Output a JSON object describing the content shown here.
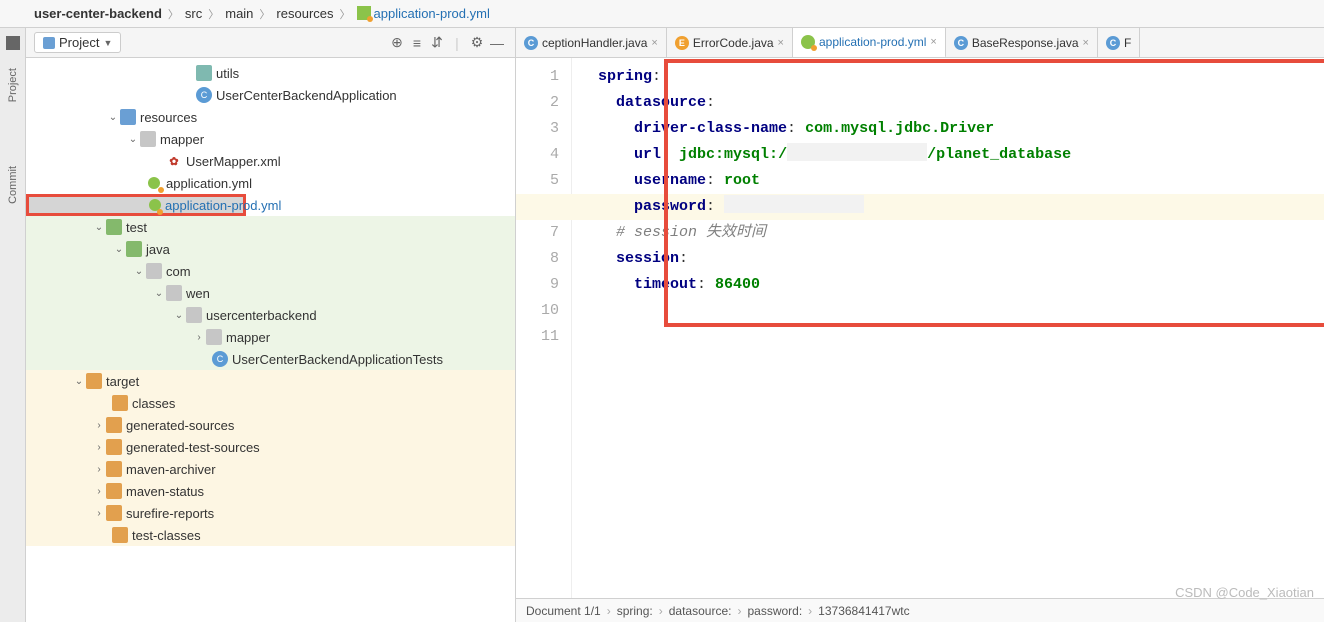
{
  "breadcrumbs": [
    "user-center-backend",
    "src",
    "main",
    "resources",
    "application-prod.yml"
  ],
  "left_rail": {
    "project": "Project",
    "commit": "Commit"
  },
  "panel_title": "Project",
  "tree": {
    "utils": "utils",
    "app_class": "UserCenterBackendApplication",
    "resources": "resources",
    "mapper": "mapper",
    "usermapper_xml": "UserMapper.xml",
    "app_yml": "application.yml",
    "app_prod_yml": "application-prod.yml",
    "test": "test",
    "java": "java",
    "com": "com",
    "wen": "wen",
    "usercenterbackend": "usercenterbackend",
    "mapper2": "mapper",
    "tests_class": "UserCenterBackendApplicationTests",
    "target": "target",
    "classes": "classes",
    "gen_sources": "generated-sources",
    "gen_test_sources": "generated-test-sources",
    "maven_archiver": "maven-archiver",
    "maven_status": "maven-status",
    "surefire": "surefire-reports",
    "test_classes": "test-classes"
  },
  "tabs": [
    {
      "icon": "java-c",
      "label": "ceptionHandler.java",
      "active": false
    },
    {
      "icon": "java-e",
      "label": "ErrorCode.java",
      "active": false
    },
    {
      "icon": "yml",
      "label": "application-prod.yml",
      "active": true
    },
    {
      "icon": "java-c",
      "label": "BaseResponse.java",
      "active": false
    },
    {
      "icon": "java-c",
      "label": "F",
      "active": false
    }
  ],
  "code": {
    "l1": {
      "k": "spring",
      "colon": ":"
    },
    "l2": {
      "k": "datasource",
      "colon": ":"
    },
    "l3": {
      "k": "driver-class-name",
      "colon": ": ",
      "v": "com.mysql.jdbc.Driver"
    },
    "l4": {
      "k": "url",
      "colon": ": ",
      "v1": "jdbc:mysql:/",
      "v2": "/planet_database"
    },
    "l5": {
      "k": "username",
      "colon": ": ",
      "v": "root"
    },
    "l6": {
      "k": "password",
      "colon": ":"
    },
    "l7": {
      "c": "# session 失效时间"
    },
    "l8": {
      "k": "session",
      "colon": ":"
    },
    "l9": {
      "k": "timeout",
      "colon": ": ",
      "v": "86400"
    }
  },
  "status": {
    "doc": "Document 1/1",
    "p1": "spring:",
    "p2": "datasource:",
    "p3": "password:",
    "p4": "13736841417wtc"
  },
  "watermark": "CSDN @Code_Xiaotian"
}
